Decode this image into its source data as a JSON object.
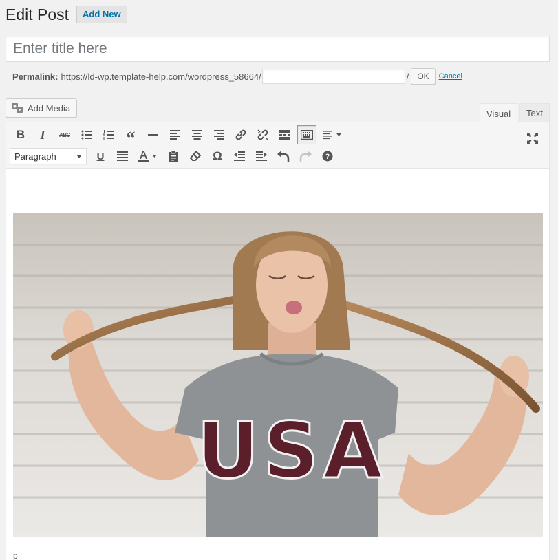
{
  "header": {
    "title": "Edit Post",
    "add_new_label": "Add New"
  },
  "title_field": {
    "placeholder": "Enter title here",
    "value": ""
  },
  "permalink": {
    "label": "Permalink:",
    "base_url": "https://ld-wp.template-help.com/wordpress_58664/",
    "slug_value": "",
    "slash": "/",
    "ok_label": "OK",
    "cancel_label": "Cancel"
  },
  "media": {
    "add_media_label": "Add Media"
  },
  "tabs": [
    {
      "label": "Visual",
      "active": true
    },
    {
      "label": "Text",
      "active": false
    }
  ],
  "toolbar": {
    "format_select_value": "Paragraph",
    "bold_glyph": "B",
    "italic_glyph": "I",
    "strike_glyph": "ABC",
    "quote_glyph": "“",
    "underline_glyph": "U",
    "omega_glyph": "Ω",
    "help_glyph": "?"
  },
  "content": {
    "image_description_icon": "photo-image",
    "tshirt_text": "USA"
  },
  "statusbar": {
    "path": "p"
  },
  "colors": {
    "background": "#f1f1f1",
    "link": "#0073aa",
    "toolbar_bg": "#f5f5f5",
    "icon": "#555555",
    "shirt_lettering": "#5a1f2b"
  }
}
